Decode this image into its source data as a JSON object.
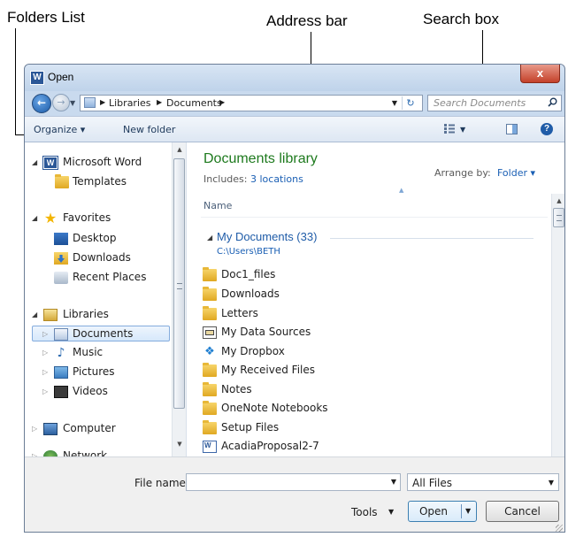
{
  "callouts": {
    "folders_list": "Folders List",
    "address_bar": "Address bar",
    "search_box": "Search box"
  },
  "window": {
    "app_icon": "W",
    "title": "Open",
    "close": "x"
  },
  "nav": {
    "back": "←",
    "forward": "→",
    "crumbs": [
      "Libraries",
      "Documents"
    ],
    "search_placeholder": "Search Documents"
  },
  "toolbar": {
    "organize": "Organize ▾",
    "new_folder": "New folder",
    "help": "?"
  },
  "sidebar": {
    "items": [
      {
        "label": "Microsoft Word",
        "icon": "word-icon"
      },
      {
        "label": "Templates",
        "icon": "folder-icon"
      },
      {
        "label": "Favorites",
        "icon": "star-icon"
      },
      {
        "label": "Desktop",
        "icon": "desktop-icon"
      },
      {
        "label": "Downloads",
        "icon": "downloads-icon"
      },
      {
        "label": "Recent Places",
        "icon": "recent-places-icon"
      },
      {
        "label": "Libraries",
        "icon": "libraries-icon"
      },
      {
        "label": "Documents",
        "icon": "documents-library-icon"
      },
      {
        "label": "Music",
        "icon": "music-icon"
      },
      {
        "label": "Pictures",
        "icon": "pictures-icon"
      },
      {
        "label": "Videos",
        "icon": "videos-icon"
      },
      {
        "label": "Computer",
        "icon": "computer-icon"
      },
      {
        "label": "Network",
        "icon": "network-icon"
      }
    ]
  },
  "main": {
    "library_title": "Documents library",
    "includes_label": "Includes:",
    "includes_link": "3 locations",
    "arrange_label": "Arrange by:",
    "arrange_value": "Folder ▾",
    "column_name": "Name",
    "group_title": "My Documents (33)",
    "group_path": "C:\\Users\\BETH",
    "files": [
      {
        "name": "Doc1_files",
        "icon": "folder-icon"
      },
      {
        "name": "Downloads",
        "icon": "folder-icon"
      },
      {
        "name": "Letters",
        "icon": "folder-icon"
      },
      {
        "name": "My Data Sources",
        "icon": "data-sources-icon"
      },
      {
        "name": "My Dropbox",
        "icon": "dropbox-icon"
      },
      {
        "name": "My Received Files",
        "icon": "folder-icon"
      },
      {
        "name": "Notes",
        "icon": "folder-icon"
      },
      {
        "name": "OneNote Notebooks",
        "icon": "folder-icon"
      },
      {
        "name": "Setup Files",
        "icon": "folder-icon"
      },
      {
        "name": "AcadiaProposal2-7",
        "icon": "word-document-icon"
      }
    ]
  },
  "footer": {
    "file_name_label": "File name:",
    "file_name_value": "",
    "filter": "All Files",
    "tools": "Tools",
    "open": "Open",
    "cancel": "Cancel"
  },
  "colors": {
    "library_title": "#1e7a1e",
    "link": "#1a5fb4",
    "chrome": "#c9daee"
  }
}
